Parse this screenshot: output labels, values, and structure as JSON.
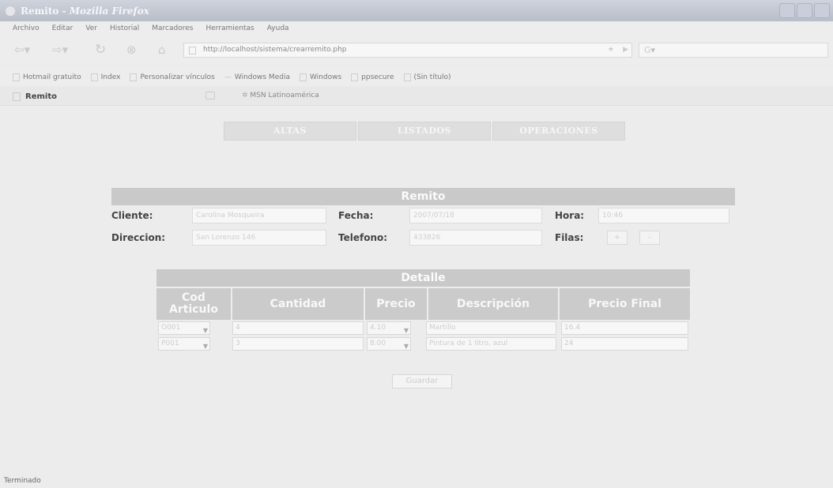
{
  "window": {
    "title_page": "Remito",
    "title_sep": " - ",
    "title_app": "Mozilla Firefox"
  },
  "menubar": [
    "Archivo",
    "Editar",
    "Ver",
    "Historial",
    "Marcadores",
    "Herramientas",
    "Ayuda"
  ],
  "navbar": {
    "url": "http://localhost/sistema/crearremito.php",
    "search_engine": "G"
  },
  "bookmarks": [
    "Hotmail gratuito",
    "Index",
    "Personalizar vínculos",
    "Windows Media",
    "Windows",
    "ppsecure",
    "(Sin título)"
  ],
  "tabs": {
    "active": "Remito",
    "second": "MSN Latinoamérica"
  },
  "site_menu": [
    "ALTAS",
    "LISTADOS",
    "OPERACIONES"
  ],
  "remito": {
    "title": "Remito",
    "cliente_label": "Cliente:",
    "cliente_value": "Carolina Mosqueira",
    "fecha_label": "Fecha:",
    "fecha_value": "2007/07/18",
    "hora_label": "Hora:",
    "hora_value": "10:46",
    "direccion_label": "Direccion:",
    "direccion_value": "San Lorenzo 146",
    "telefono_label": "Telefono:",
    "telefono_value": "433826",
    "filas_label": "Filas:",
    "filas_plus": "+",
    "filas_minus": "-"
  },
  "detalle": {
    "title": "Detalle",
    "columns": [
      "Cod Articulo",
      "Cantidad",
      "Precio",
      "Descripción",
      "Precio Final"
    ],
    "rows": [
      {
        "cod": "O001",
        "cantidad": "4",
        "precio": "4.10",
        "descripcion": "Martillo",
        "precio_final": "16.4"
      },
      {
        "cod": "P001",
        "cantidad": "3",
        "precio": "8.00",
        "descripcion": "Pintura de 1 litro, azul",
        "precio_final": "24"
      }
    ]
  },
  "guardar_label": "Guardar",
  "status": "Terminado"
}
